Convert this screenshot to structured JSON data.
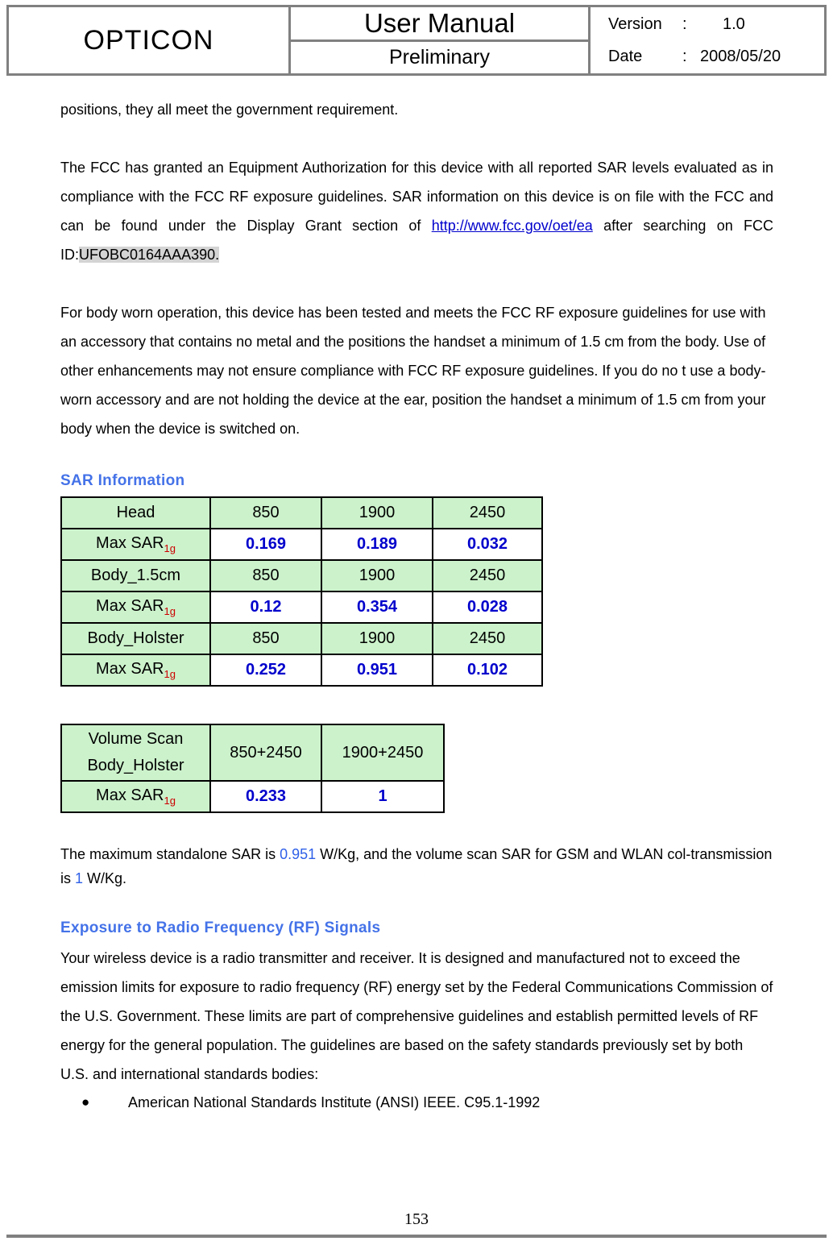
{
  "header": {
    "logo": "OPTICON",
    "title": "User Manual",
    "subtitle": "Preliminary",
    "version_label": "Version",
    "version_colon": ":",
    "version_value": "1.0",
    "date_label": "Date",
    "date_colon": ":",
    "date_value": "2008/05/20"
  },
  "body": {
    "para_positions": "positions, they all meet the government requirement.",
    "para_fcc_1": "The FCC has granted an Equipment Authorization for this device with all reported SAR levels evaluated as in compliance with the FCC RF exposure guidelines. SAR information on this device is on file with the FCC and can be found under the Display Grant section of ",
    "fcc_link": "http://www.fcc.gov/oet/ea",
    "para_fcc_2": " after searching on FCC ID:",
    "fcc_id": "UFOBC0164AAA390.",
    "para_bodyworn": "For body worn operation, this device has been tested and meets the FCC RF exposure guidelines for use with an accessory that contains no metal and the positions the handset a minimum of 1.5 cm from the body. Use of other enhancements may not ensure compliance with FCC RF exposure guidelines. If you do no t use a body-worn accessory and are not holding the device at the ear, position the handset a minimum of 1.5 cm from your body when the device is switched on.",
    "sar_heading": "SAR Information",
    "summary_pre": "The maximum standalone SAR is ",
    "summary_max": "0.951",
    "summary_mid": " W/Kg, and the volume scan SAR for GSM and WLAN col-transmission is ",
    "summary_vol": "1",
    "summary_post": " W/Kg.",
    "rf_heading": "Exposure to Radio Frequency (RF) Signals",
    "para_rf": "Your wireless device is a radio transmitter and receiver. It is designed and manufactured not to exceed the emission limits for exposure to radio frequency (RF) energy set by the Federal Communications Commission of the U.S. Government. These limits are part of comprehensive guidelines and establish permitted levels of RF energy for the general population. The guidelines are based on the safety standards previously set by both U.S. and international standards bodies:",
    "bullet_glyph": "●",
    "bullets": [
      "American National Standards Institute (ANSI) IEEE. C95.1-1992"
    ]
  },
  "sar_table_main": {
    "label_maxsar": "Max SAR",
    "label_sub": "1g",
    "rows": [
      {
        "type": "freq",
        "label": "Head",
        "cells": [
          "850",
          "1900",
          "2450"
        ]
      },
      {
        "type": "val",
        "label": "Max SAR",
        "cells": [
          "0.169",
          "0.189",
          "0.032"
        ]
      },
      {
        "type": "freq",
        "label": "Body_1.5cm",
        "cells": [
          "850",
          "1900",
          "2450"
        ]
      },
      {
        "type": "val",
        "label": "Max SAR",
        "cells": [
          "0.12",
          "0.354",
          "0.028"
        ]
      },
      {
        "type": "freq",
        "label": "Body_Holster",
        "cells": [
          "850",
          "1900",
          "2450"
        ]
      },
      {
        "type": "val",
        "label": "Max SAR",
        "cells": [
          "0.252",
          "0.951",
          "0.102"
        ]
      }
    ]
  },
  "sar_table_volume": {
    "header_line1": "Volume Scan",
    "header_line2": "Body_Holster",
    "header_cells": [
      "850+2450",
      "1900+2450"
    ],
    "value_label": "Max SAR",
    "value_sub": "1g",
    "values": [
      "0.233",
      "1"
    ]
  },
  "footer": {
    "page_number": "153"
  },
  "colors": {
    "heading_blue": "#4472E8",
    "value_blue": "#0000CC",
    "subscript_red": "#CC0000",
    "table_green": "#ccf2cc",
    "border_gray": "#808080",
    "highlight_gray": "#d4d4d4"
  }
}
